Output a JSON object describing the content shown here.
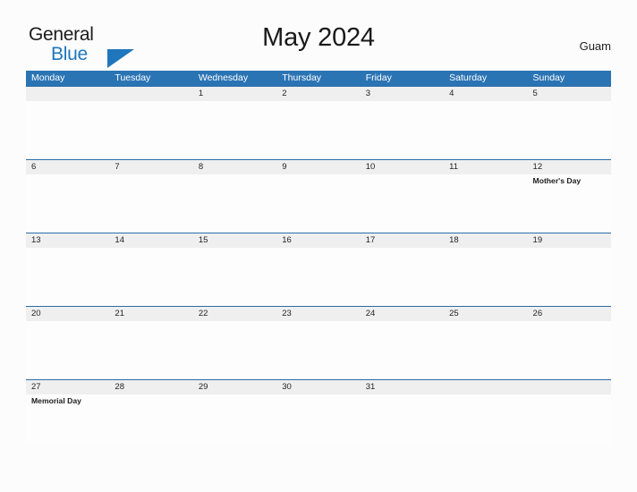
{
  "brand": {
    "line1": "General",
    "line2": "Blue",
    "flag_icon": "blue-triangle-flag-icon",
    "accent_color": "#1f76bd"
  },
  "header": {
    "title": "May 2024",
    "locale": "Guam"
  },
  "theme": {
    "header_blue": "#2b74b4",
    "row_band_gray": "#efefef",
    "grid_rule_blue": "#2b6ca8",
    "page_background": "#fcfcfd",
    "text_color": "#1a1a1a"
  },
  "calendar": {
    "month": "May",
    "year": "2024",
    "week_start": "Monday",
    "weekdays": [
      "Monday",
      "Tuesday",
      "Wednesday",
      "Thursday",
      "Friday",
      "Saturday",
      "Sunday"
    ],
    "weeks": [
      {
        "dates": [
          "",
          "",
          "1",
          "2",
          "3",
          "4",
          "5"
        ],
        "events": [
          [],
          [],
          [],
          [],
          [],
          [],
          []
        ]
      },
      {
        "dates": [
          "6",
          "7",
          "8",
          "9",
          "10",
          "11",
          "12"
        ],
        "events": [
          [],
          [],
          [],
          [],
          [],
          [],
          [
            "Mother's Day"
          ]
        ]
      },
      {
        "dates": [
          "13",
          "14",
          "15",
          "16",
          "17",
          "18",
          "19"
        ],
        "events": [
          [],
          [],
          [],
          [],
          [],
          [],
          []
        ]
      },
      {
        "dates": [
          "20",
          "21",
          "22",
          "23",
          "24",
          "25",
          "26"
        ],
        "events": [
          [],
          [],
          [],
          [],
          [],
          [],
          []
        ]
      },
      {
        "dates": [
          "27",
          "28",
          "29",
          "30",
          "31",
          "",
          ""
        ],
        "events": [
          [
            "Memorial Day"
          ],
          [],
          [],
          [],
          [],
          [],
          []
        ]
      }
    ],
    "holidays": [
      {
        "date": "12",
        "weekday": "Sunday",
        "name": "Mother's Day"
      },
      {
        "date": "27",
        "weekday": "Monday",
        "name": "Memorial Day"
      }
    ]
  }
}
